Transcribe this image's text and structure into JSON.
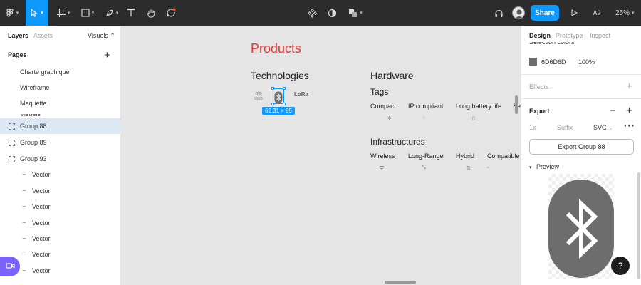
{
  "toolbar": {
    "share_label": "Share",
    "aa_label": "A?",
    "zoom_label": "25%"
  },
  "left_panel": {
    "tabs": {
      "layers": "Layers",
      "assets": "Assets",
      "visuels": "Visuels ⌃"
    },
    "pages_heading": "Pages",
    "pages": [
      "Charte graphique",
      "Wireframe",
      "Maquette"
    ],
    "partial_label": "Visuels",
    "layers": [
      {
        "name": "Group 88",
        "selected": true
      },
      {
        "name": "Group 89",
        "selected": false
      },
      {
        "name": "Group 93",
        "selected": false
      },
      {
        "name": "Vector"
      },
      {
        "name": "Vector"
      },
      {
        "name": "Vector"
      },
      {
        "name": "Vector"
      },
      {
        "name": "Vector"
      },
      {
        "name": "Vector"
      },
      {
        "name": "Vector"
      }
    ]
  },
  "canvas": {
    "products_title": "Products",
    "technologies_title": "Technologies",
    "tech_icons": [
      "UWB",
      "Bluetooth",
      "LoRa"
    ],
    "selection_dims": "62.31 × 95",
    "hardware_title": "Hardware",
    "tags_title": "Tags",
    "tags": [
      "Compact",
      "IP compliant",
      "Long battery life",
      "Se"
    ],
    "infrastructures_title": "Infrastructures",
    "infrastructures": [
      "Wireless",
      "Long-Range",
      "Hybrid",
      "Compatible"
    ]
  },
  "right_panel": {
    "tabs": {
      "design": "Design",
      "prototype": "Prototype",
      "inspect": "Inspect"
    },
    "selection_colors_label": "Selection colors",
    "color_hex": "6D6D6D",
    "color_opacity": "100%",
    "effects_label": "Effects",
    "export_label": "Export",
    "export_scale": "1x",
    "export_suffix": "Suffix",
    "export_format": "SVG",
    "export_button": "Export Group 88",
    "preview_label": "Preview",
    "help_label": "?",
    "colors": {
      "accent": "#0d99ff",
      "products": "#e53935",
      "swatch": "#6d6d6d"
    }
  }
}
